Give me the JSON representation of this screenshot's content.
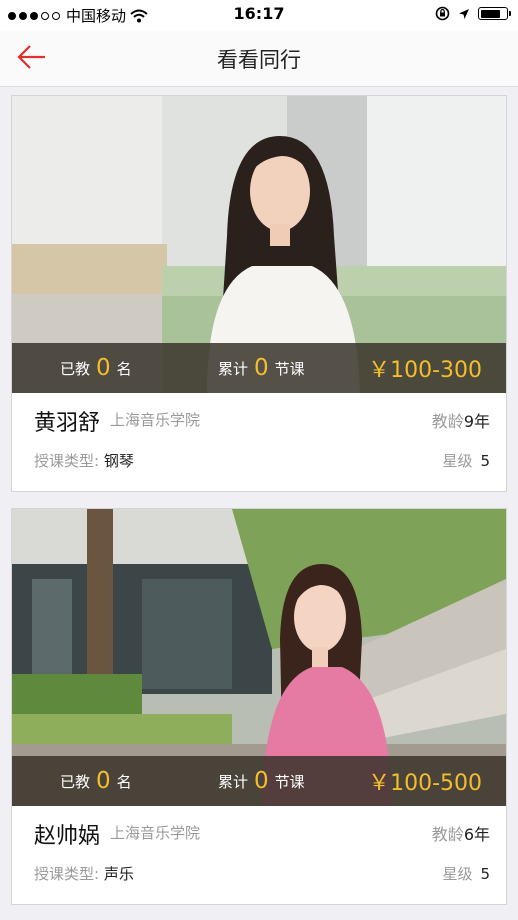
{
  "status_bar": {
    "carrier": "中国移动",
    "time": "16:17",
    "battery_level": 0.8
  },
  "nav": {
    "title": "看看同行",
    "back_icon": "back-arrow-icon",
    "accent_color": "#e0312b"
  },
  "cards": [
    {
      "taught_prefix": "已教",
      "taught_count": "0",
      "taught_unit": "名",
      "lessons_prefix": "累计",
      "lessons_count": "0",
      "lessons_unit": "节课",
      "price": "￥100-300",
      "name": "黄羽舒",
      "school": "上海音乐学院",
      "teach_age_label": "教龄",
      "teach_age_value": "9年",
      "type_label": "授课类型:",
      "type_value": "钢琴",
      "star_label": "星级",
      "star_value": "5"
    },
    {
      "taught_prefix": "已教",
      "taught_count": "0",
      "taught_unit": "名",
      "lessons_prefix": "累计",
      "lessons_count": "0",
      "lessons_unit": "节课",
      "price": "￥100-500",
      "name": "赵帅娲",
      "school": "上海音乐学院",
      "teach_age_label": "教龄",
      "teach_age_value": "6年",
      "type_label": "授课类型:",
      "type_value": "声乐",
      "star_label": "星级",
      "star_value": "5"
    }
  ]
}
